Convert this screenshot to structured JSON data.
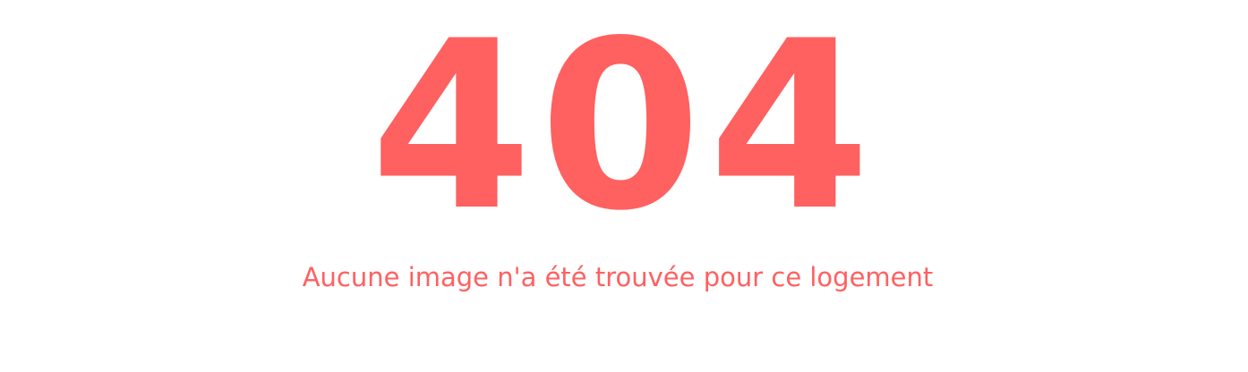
{
  "error": {
    "code": "404",
    "message": "Aucune image n'a été trouvée pour ce logement"
  },
  "colors": {
    "accent": "#FF6060",
    "background": "#FFFFFF"
  }
}
